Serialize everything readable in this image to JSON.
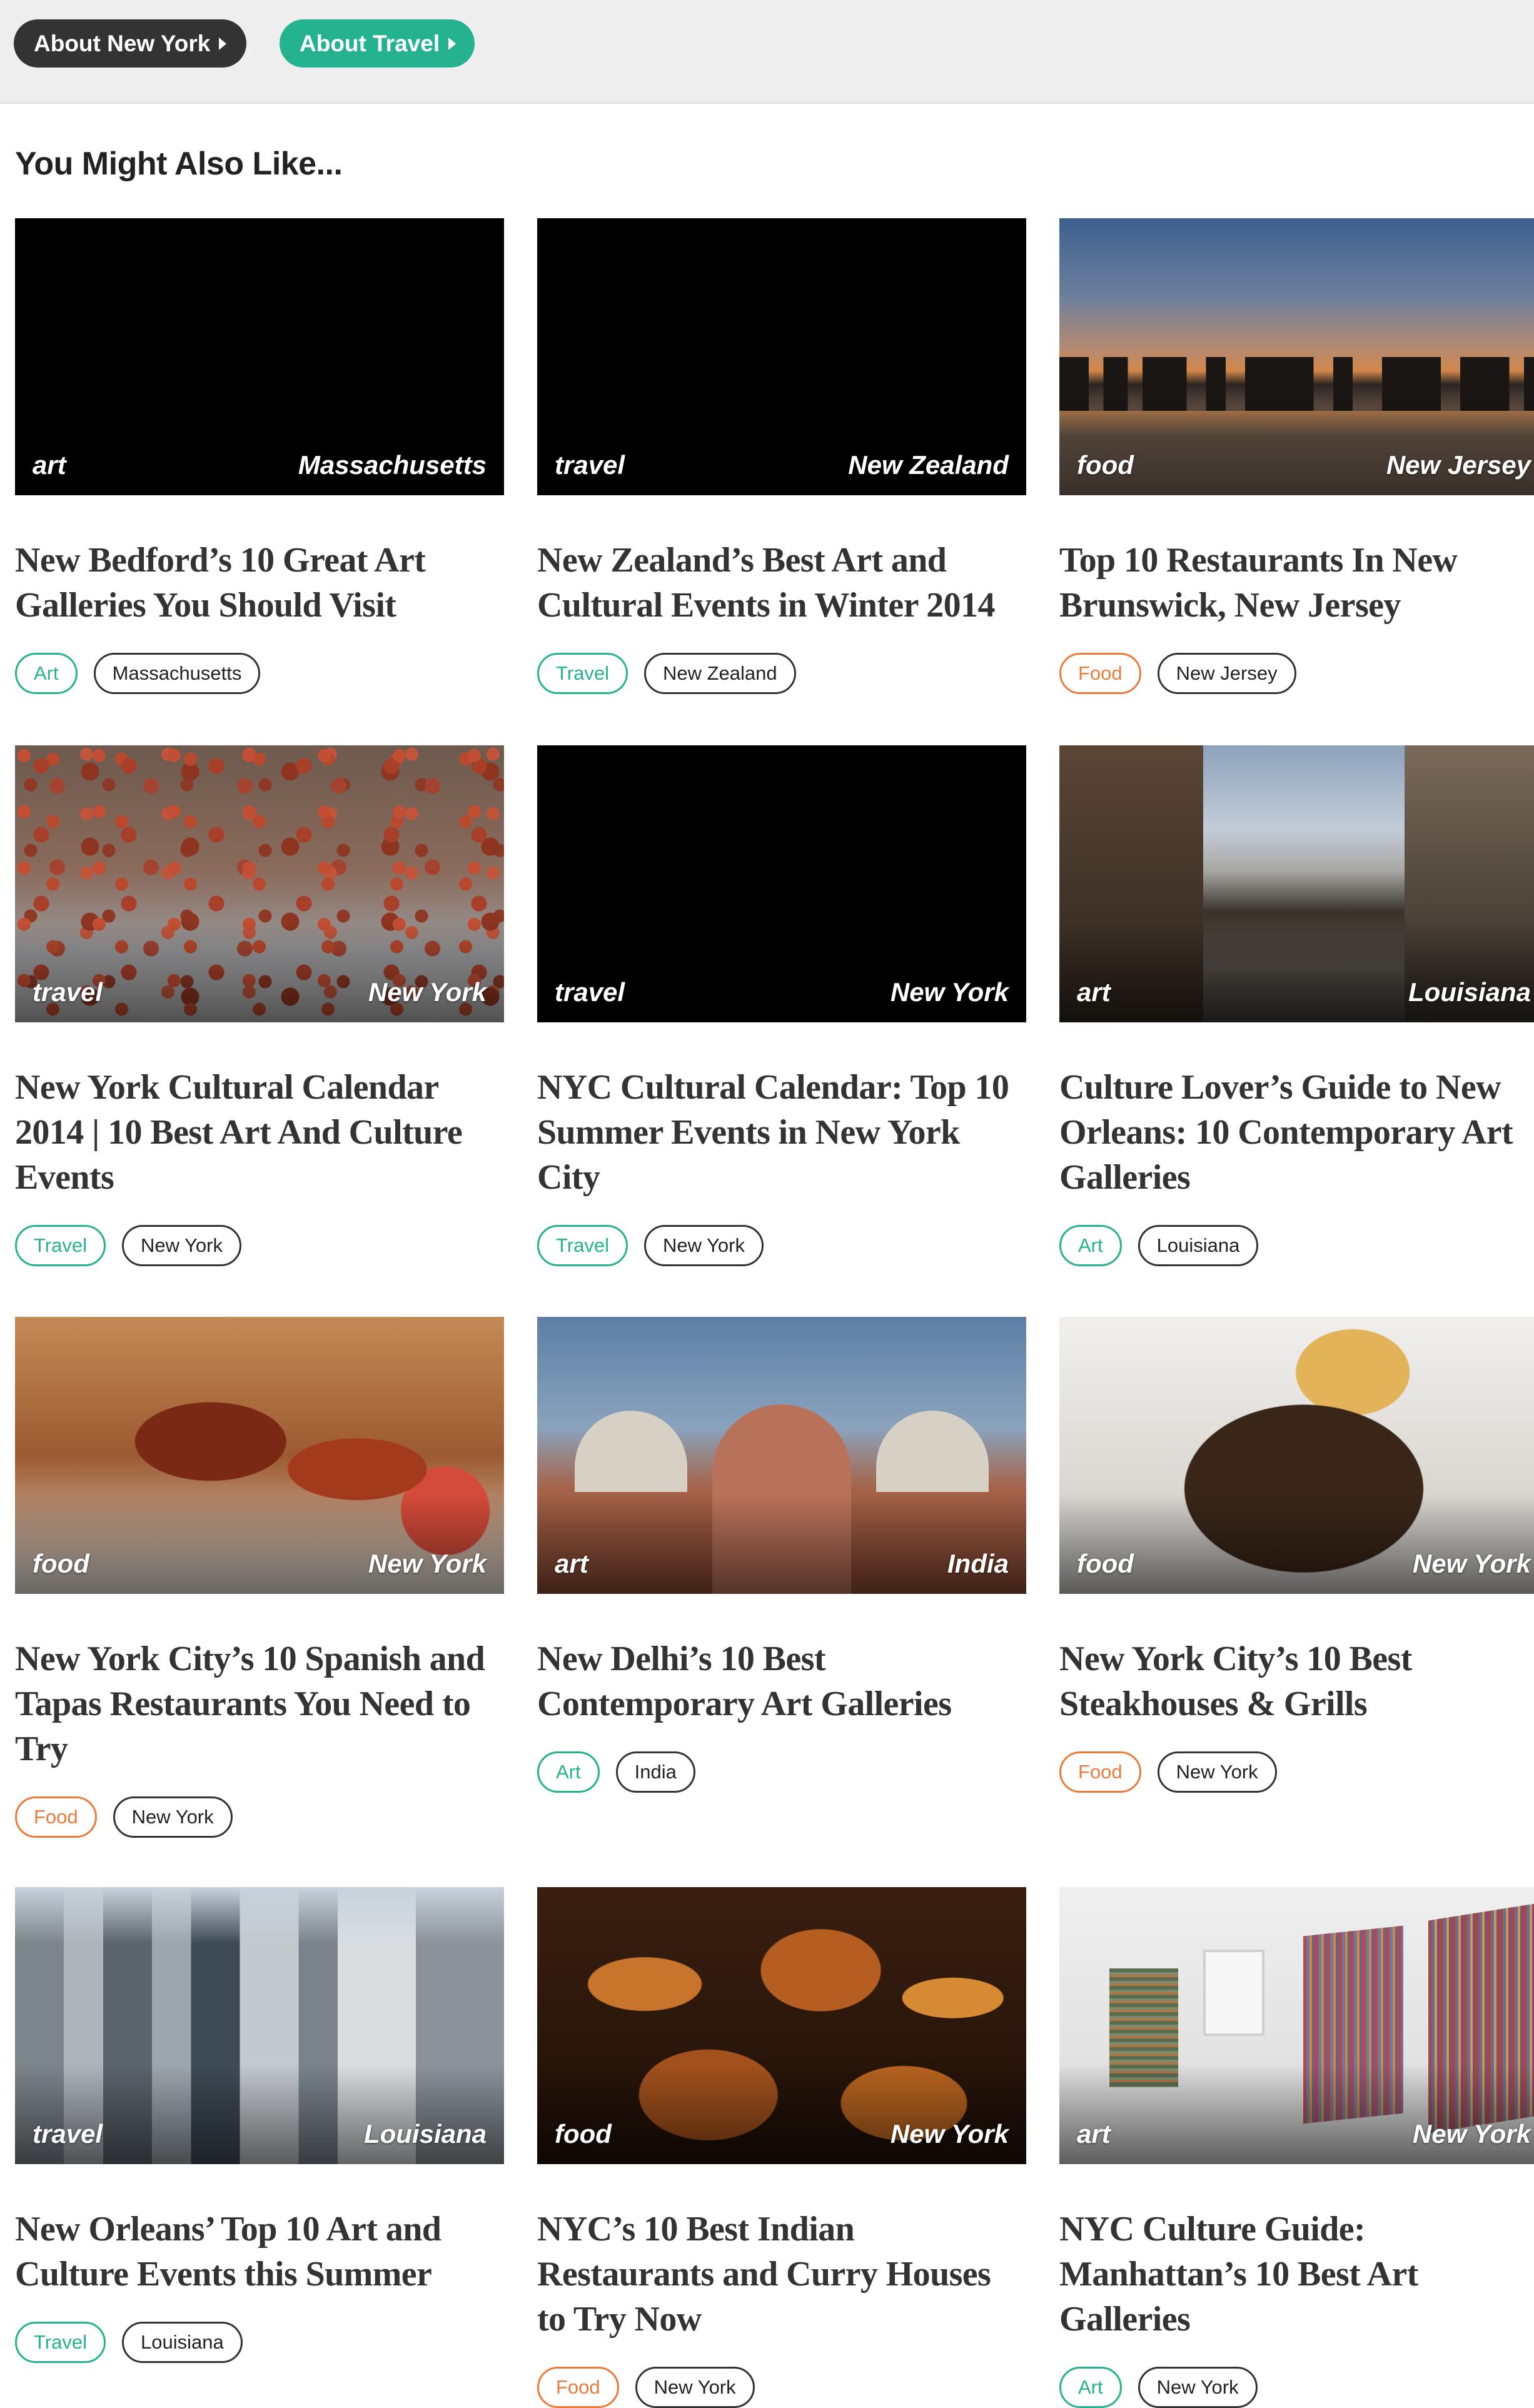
{
  "topbar": {
    "about_city": "About New York",
    "about_topic": "About Travel"
  },
  "section_title": "You Might Also Like...",
  "cards": [
    {
      "category": "art",
      "location": "Massachusetts",
      "title": "New Bedford’s 10 Great Art Galleries You Should Visit",
      "tag_category": "Art",
      "tag_location": "Massachusetts"
    },
    {
      "category": "travel",
      "location": "New Zealand",
      "title": "New Zealand’s Best Art and Cultural Events in Winter 2014",
      "tag_category": "Travel",
      "tag_location": "New Zealand"
    },
    {
      "category": "food",
      "location": "New Jersey",
      "title": "Top 10 Restaurants In New Brunswick, New Jersey",
      "tag_category": "Food",
      "tag_location": "New Jersey"
    },
    {
      "category": "travel",
      "location": "New York",
      "title": "New York Cultural Calendar 2014 | 10 Best Art And Culture Events",
      "tag_category": "Travel",
      "tag_location": "New York"
    },
    {
      "category": "travel",
      "location": "New York",
      "title": "NYC Cultural Calendar: Top 10 Summer Events in New York City",
      "tag_category": "Travel",
      "tag_location": "New York"
    },
    {
      "category": "art",
      "location": "Louisiana",
      "title": "Culture Lover’s Guide to New Orleans: 10 Contemporary Art Galleries",
      "tag_category": "Art",
      "tag_location": "Louisiana"
    },
    {
      "category": "food",
      "location": "New York",
      "title": "New York City’s 10 Spanish and Tapas Restaurants You Need to Try",
      "tag_category": "Food",
      "tag_location": "New York"
    },
    {
      "category": "art",
      "location": "India",
      "title": "New Delhi’s 10 Best Contemporary Art Galleries",
      "tag_category": "Art",
      "tag_location": "India"
    },
    {
      "category": "food",
      "location": "New York",
      "title": "New York City’s 10 Best Steakhouses & Grills",
      "tag_category": "Food",
      "tag_location": "New York"
    },
    {
      "category": "travel",
      "location": "Louisiana",
      "title": "New Orleans’ Top 10 Art and Culture Events this Summer",
      "tag_category": "Travel",
      "tag_location": "Louisiana"
    },
    {
      "category": "food",
      "location": "New York",
      "title": "NYC’s 10 Best Indian Restaurants and Curry Houses to Try Now",
      "tag_category": "Food",
      "tag_location": "New York"
    },
    {
      "category": "art",
      "location": "New York",
      "title": "NYC Culture Guide: Manhattan’s 10 Best Art Galleries",
      "tag_category": "Art",
      "tag_location": "New York"
    }
  ],
  "colors": {
    "accent_green": "#25b38f",
    "food_orange": "#ec7a3a",
    "dark_pill": "#333333"
  }
}
